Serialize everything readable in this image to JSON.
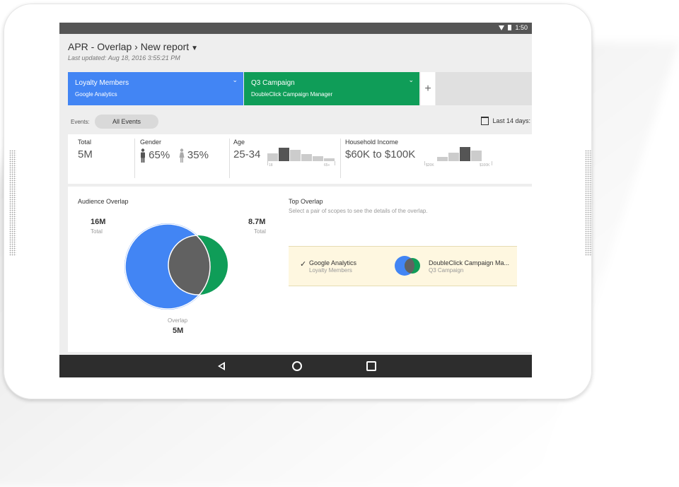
{
  "status_bar": {
    "time": "1:50"
  },
  "header": {
    "title": "APR - Overlap",
    "separator": "›",
    "report": "New report",
    "last_updated": "Last updated: Aug 18, 2016 3:55:21 PM"
  },
  "scopes": [
    {
      "name": "Loyalty Members",
      "source": "Google Analytics",
      "color": "#4285f4"
    },
    {
      "name": "Q3 Campaign",
      "source": "DoubleClick Campaign Manager",
      "color": "#0f9d58"
    }
  ],
  "add_scope_label": "+",
  "filters": {
    "events_label": "Events:",
    "events_value": "All Events",
    "date_range": "Last 14 days:"
  },
  "stats": {
    "total": {
      "label": "Total",
      "value": "5M"
    },
    "gender": {
      "label": "Gender",
      "male": "65%",
      "female": "35%"
    },
    "age": {
      "label": "Age",
      "value": "25-34",
      "tick_min": "18",
      "tick_max": "65+",
      "bars": [
        0.55,
        0.95,
        0.8,
        0.5,
        0.35,
        0.2
      ],
      "selected_index": 1
    },
    "income": {
      "label": "Household Income",
      "value": "$60K to $100K",
      "tick_min": "$20K",
      "tick_max": "$100K",
      "bars": [
        0.3,
        0.6,
        1.0,
        0.75
      ],
      "selected_index": 2
    }
  },
  "audience_overlap": {
    "title": "Audience Overlap",
    "left_total": "16M",
    "left_total_label": "Total",
    "right_total": "8.7M",
    "right_total_label": "Total",
    "overlap_label": "Overlap",
    "overlap_value": "5M",
    "colors": {
      "left": "#4285f4",
      "right": "#0f9d58",
      "overlap": "#616161"
    }
  },
  "top_overlap": {
    "title": "Top Overlap",
    "hint": "Select a pair of scopes to see the details of the overlap.",
    "check": "✓",
    "scope_a": {
      "name": "Google Analytics",
      "sub": "Loyalty Members"
    },
    "scope_b": {
      "name": "DoubleClick Campaign Ma...",
      "sub": "Q3 Campaign"
    }
  }
}
